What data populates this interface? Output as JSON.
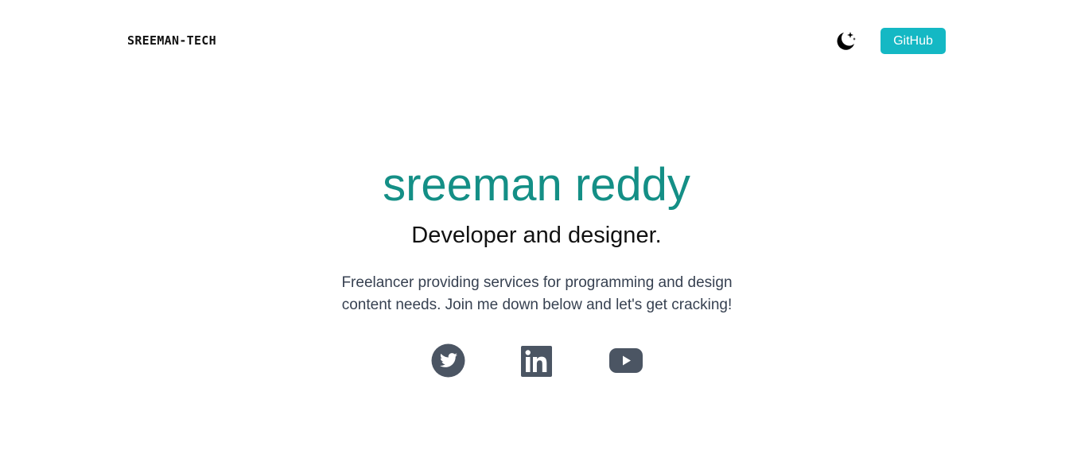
{
  "header": {
    "brand": "SREEMAN-TECH",
    "theme_toggle_icon": "moon-stars-icon",
    "github_label": "GitHub"
  },
  "hero": {
    "name": "sreeman reddy",
    "role": "Developer and designer.",
    "description": "Freelancer providing services for programming and design content needs. Join me down below and let's get cracking!"
  },
  "social": [
    {
      "icon": "twitter-icon"
    },
    {
      "icon": "linkedin-icon"
    },
    {
      "icon": "youtube-icon"
    }
  ],
  "colors": {
    "accent_teal": "#148f86",
    "button_bg": "#14b8c4",
    "icon_gray": "#4b5563",
    "text_dark": "#111111",
    "text_body": "#374151"
  }
}
